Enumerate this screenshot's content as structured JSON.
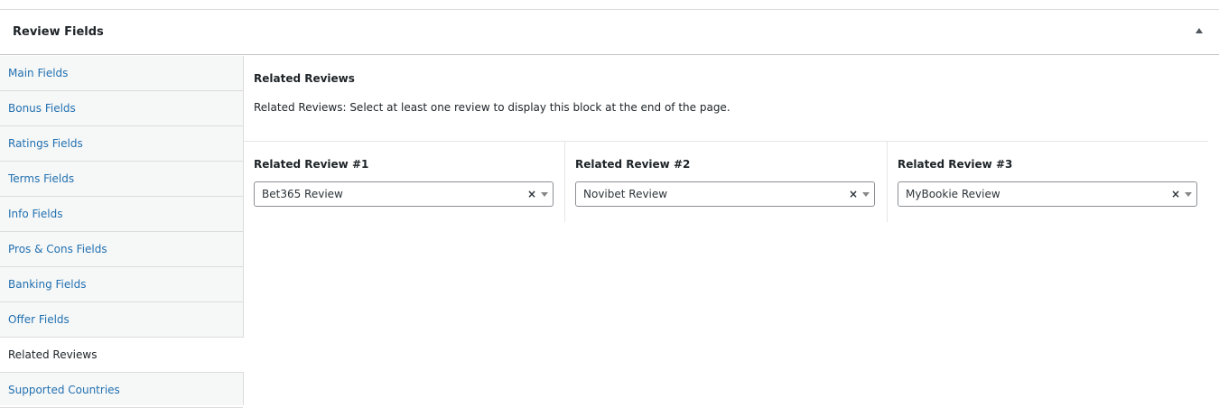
{
  "metabox": {
    "title": "Review Fields"
  },
  "sidebar": {
    "items": [
      {
        "label": "Main Fields",
        "active": false
      },
      {
        "label": "Bonus Fields",
        "active": false
      },
      {
        "label": "Ratings Fields",
        "active": false
      },
      {
        "label": "Terms Fields",
        "active": false
      },
      {
        "label": "Info Fields",
        "active": false
      },
      {
        "label": "Pros & Cons Fields",
        "active": false
      },
      {
        "label": "Banking Fields",
        "active": false
      },
      {
        "label": "Offer Fields",
        "active": false
      },
      {
        "label": "Related Reviews",
        "active": true
      },
      {
        "label": "Supported Countries",
        "active": false
      }
    ]
  },
  "content": {
    "title": "Related Reviews",
    "description": "Related Reviews: Select at least one review to display this block at the end of the page.",
    "fields": [
      {
        "label": "Related Review #1",
        "value": "Bet365 Review",
        "clear": "×"
      },
      {
        "label": "Related Review #2",
        "value": "Novibet Review",
        "clear": "×"
      },
      {
        "label": "Related Review #3",
        "value": "MyBookie Review",
        "clear": "×"
      }
    ]
  },
  "icons": {
    "toggle": "triangle-up-icon",
    "dropdown": "caret-down-icon"
  },
  "colors": {
    "link": "#2271b1",
    "text": "#1d2327",
    "sidebar_bg": "#f6f7f7",
    "border": "#dcdcde"
  }
}
